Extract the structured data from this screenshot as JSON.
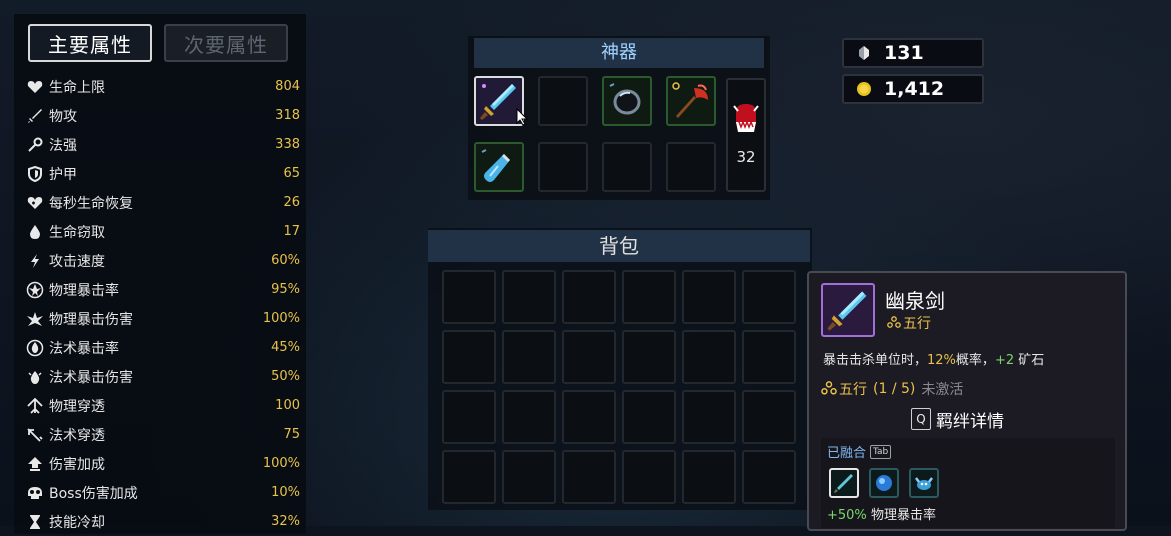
{
  "tabs": {
    "primary": "主要属性",
    "secondary": "次要属性"
  },
  "stats": [
    {
      "icon": "heart-icon",
      "label": "生命上限",
      "value": "804"
    },
    {
      "icon": "sword-icon",
      "label": "物攻",
      "value": "318"
    },
    {
      "icon": "staff-icon",
      "label": "法强",
      "value": "338"
    },
    {
      "icon": "shield-icon",
      "label": "护甲",
      "value": "65"
    },
    {
      "icon": "heart-regen-icon",
      "label": "每秒生命恢复",
      "value": "26"
    },
    {
      "icon": "blood-drop-icon",
      "label": "生命窃取",
      "value": "17"
    },
    {
      "icon": "lightning-icon",
      "label": "攻击速度",
      "value": "60%"
    },
    {
      "icon": "physical-crit-icon",
      "label": "物理暴击率",
      "value": "95%"
    },
    {
      "icon": "physical-crit-damage-icon",
      "label": "物理暴击伤害",
      "value": "100%"
    },
    {
      "icon": "magic-crit-icon",
      "label": "法术暴击率",
      "value": "45%"
    },
    {
      "icon": "magic-crit-damage-icon",
      "label": "法术暴击伤害",
      "value": "50%"
    },
    {
      "icon": "physical-penetration-icon",
      "label": "物理穿透",
      "value": "100"
    },
    {
      "icon": "magic-penetration-icon",
      "label": "法术穿透",
      "value": "75"
    },
    {
      "icon": "damage-bonus-icon",
      "label": "伤害加成",
      "value": "100%"
    },
    {
      "icon": "boss-skull-icon",
      "label": "Boss伤害加成",
      "value": "10%"
    },
    {
      "icon": "hourglass-icon",
      "label": "技能冷却",
      "value": "32%"
    }
  ],
  "artifacts": {
    "title": "神器",
    "demon_count": "32"
  },
  "resources": {
    "crystal": "131",
    "gold": "1,412"
  },
  "backpack": {
    "title": "背包",
    "rows": 4,
    "cols": 6
  },
  "tooltip": {
    "name": "幽泉剑",
    "tag": "五行",
    "desc_prefix": "暴击击杀单位时，",
    "desc_chance": "12%",
    "desc_mid": "概率，",
    "desc_bonus": "+2",
    "desc_suffix": " 矿石",
    "set_name": "五行",
    "set_progress": "(1 / 5)",
    "set_status": "未激活",
    "bond_key": "Q",
    "bond_label": "羁绊详情",
    "fused_title": "已融合",
    "fused_key": "Tab",
    "fused_bonus_value": "+50%",
    "fused_bonus_label": "物理暴击率"
  },
  "colors": {
    "stat_value": "#e8c24a",
    "panel_header": "#213247",
    "artifact_title_text": "#9fd1ff",
    "rarity_purple": "#a070d8",
    "bonus_green": "#7ad86a"
  }
}
